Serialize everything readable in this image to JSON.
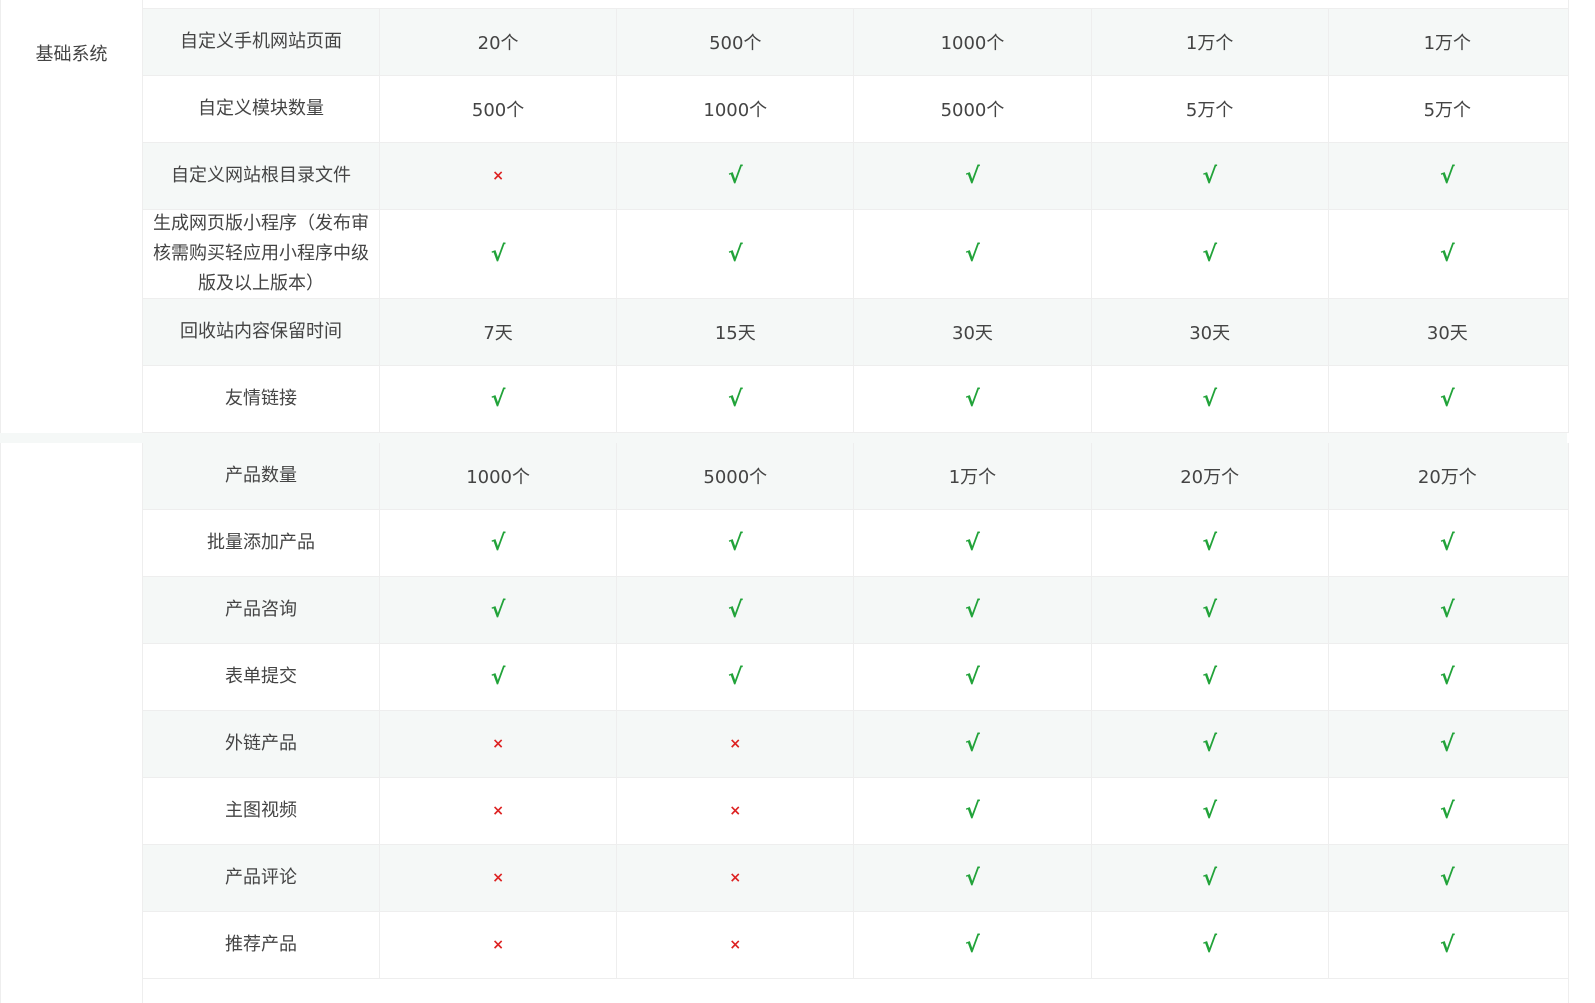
{
  "colors": {
    "check": "#22a33a",
    "cross": "#dd2222",
    "alt_row": "#f5f8f7",
    "border": "#eeeeee"
  },
  "icons": {
    "check": "checkmark-icon",
    "cross": "cross-icon"
  },
  "glyphs": {
    "check": "√",
    "cross": "×"
  },
  "sections": [
    {
      "label": "基础系统",
      "rows": [
        {
          "feature": "自定义手机网站页面",
          "values": [
            "20个",
            "500个",
            "1000个",
            "1万个",
            "1万个"
          ]
        },
        {
          "feature": "自定义模块数量",
          "values": [
            "500个",
            "1000个",
            "5000个",
            "5万个",
            "5万个"
          ]
        },
        {
          "feature": "自定义网站根目录文件",
          "values": [
            "cross",
            "check",
            "check",
            "check",
            "check"
          ]
        },
        {
          "feature": "生成网页版小程序（发布审核需购买轻应用小程序中级版及以上版本）",
          "values": [
            "check",
            "check",
            "check",
            "check",
            "check"
          ]
        },
        {
          "feature": "回收站内容保留时间",
          "values": [
            "7天",
            "15天",
            "30天",
            "30天",
            "30天"
          ]
        },
        {
          "feature": "友情链接",
          "values": [
            "check",
            "check",
            "check",
            "check",
            "check"
          ]
        }
      ]
    },
    {
      "label": "",
      "rows": [
        {
          "feature": "产品数量",
          "values": [
            "1000个",
            "5000个",
            "1万个",
            "20万个",
            "20万个"
          ]
        },
        {
          "feature": "批量添加产品",
          "values": [
            "check",
            "check",
            "check",
            "check",
            "check"
          ]
        },
        {
          "feature": "产品咨询",
          "values": [
            "check",
            "check",
            "check",
            "check",
            "check"
          ]
        },
        {
          "feature": "表单提交",
          "values": [
            "check",
            "check",
            "check",
            "check",
            "check"
          ]
        },
        {
          "feature": "外链产品",
          "values": [
            "cross",
            "cross",
            "check",
            "check",
            "check"
          ]
        },
        {
          "feature": "主图视频",
          "values": [
            "cross",
            "cross",
            "check",
            "check",
            "check"
          ]
        },
        {
          "feature": "产品评论",
          "values": [
            "cross",
            "cross",
            "check",
            "check",
            "check"
          ]
        },
        {
          "feature": "推荐产品",
          "values": [
            "cross",
            "cross",
            "check",
            "check",
            "check"
          ]
        }
      ]
    }
  ]
}
